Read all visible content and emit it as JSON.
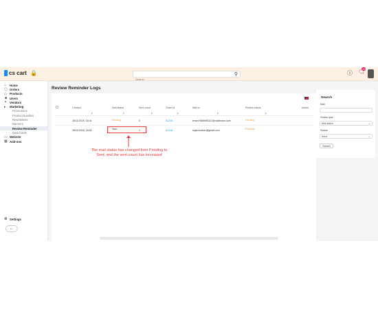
{
  "app": {
    "logo_text": "cs cart",
    "search_placeholder": "Search",
    "notification_count": "20"
  },
  "sidebar": {
    "items": [
      {
        "label": "Home",
        "icon": "home-icon"
      },
      {
        "label": "Orders",
        "icon": "orders-icon"
      },
      {
        "label": "Products",
        "icon": "tag-icon"
      },
      {
        "label": "Users",
        "icon": "user-icon"
      },
      {
        "label": "Vendors",
        "icon": "vendors-icon"
      },
      {
        "label": "Marketing",
        "icon": "megaphone-icon"
      }
    ],
    "marketing_sub": [
      {
        "label": "Promotions",
        "active": false
      },
      {
        "label": "Product bundles",
        "active": false
      },
      {
        "label": "Newsletters",
        "active": false
      },
      {
        "label": "Banners",
        "active": false
      },
      {
        "label": "Review Reminder",
        "active": true
      },
      {
        "label": "Data feeds",
        "active": false
      }
    ],
    "items_after": [
      {
        "label": "Website",
        "icon": "monitor-icon"
      },
      {
        "label": "Add-ons",
        "icon": "puzzle-icon"
      }
    ],
    "settings_label": "Settings"
  },
  "page": {
    "title": "Review Reminder Logs"
  },
  "table": {
    "headers": [
      "Created",
      "Mail status",
      "Sent count",
      "Order Id",
      "Mail to",
      "Review status",
      "Action"
    ],
    "rows": [
      {
        "created": "28/11/2025, 18:41",
        "mail_status": "Pending",
        "sent_count": "0",
        "order_id": "#1218",
        "mail_to": "tester7868666321@mailinator.com",
        "review_status": "Pending"
      },
      {
        "created": "28/11/2025, 18:52",
        "mail_status": "Sent",
        "sent_count": "1",
        "order_id": "#1218",
        "mail_to": "kajal.ecarter@gmail.com",
        "review_status": "Pending"
      }
    ]
  },
  "annotation": {
    "text": "The mail status has changed from Pending to Sent, and the sent count has increased"
  },
  "search_panel": {
    "title": "Search",
    "mail_label": "Mail",
    "status_type_label": "Status type",
    "status_type_value": "Mail status",
    "status_label": "Status",
    "status_value": "Send",
    "search_button": "Search"
  },
  "colors": {
    "pending": "#f0a030",
    "link": "#2196f3",
    "annotation": "#e53935"
  }
}
